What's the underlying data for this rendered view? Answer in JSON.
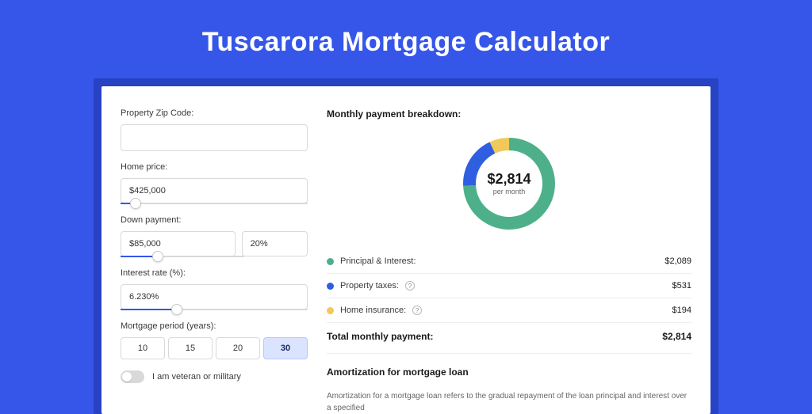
{
  "title": "Tuscarora Mortgage Calculator",
  "form": {
    "zip": {
      "label": "Property Zip Code:",
      "value": ""
    },
    "price": {
      "label": "Home price:",
      "value": "$425,000",
      "slider_pct": 8
    },
    "down": {
      "label": "Down payment:",
      "amount": "$85,000",
      "pct": "20%",
      "slider_pct": 20
    },
    "rate": {
      "label": "Interest rate (%):",
      "value": "6.230%",
      "slider_pct": 30
    },
    "period": {
      "label": "Mortgage period (years):",
      "options": [
        "10",
        "15",
        "20",
        "30"
      ],
      "active": "30"
    },
    "veteran_label": "I am veteran or military"
  },
  "breakdown": {
    "title": "Monthly payment breakdown:",
    "center_amount": "$2,814",
    "center_label": "per month",
    "items": [
      {
        "label": "Principal & Interest:",
        "value": "$2,089",
        "color": "#4db08b",
        "info": false,
        "num": 2089
      },
      {
        "label": "Property taxes:",
        "value": "$531",
        "color": "#2f5fe0",
        "info": true,
        "num": 531
      },
      {
        "label": "Home insurance:",
        "value": "$194",
        "color": "#f0c95a",
        "info": true,
        "num": 194
      }
    ],
    "total_label": "Total monthly payment:",
    "total_value": "$2,814"
  },
  "amort": {
    "title": "Amortization for mortgage loan",
    "text": "Amortization for a mortgage loan refers to the gradual repayment of the loan principal and interest over a specified"
  },
  "chart_data": {
    "type": "pie",
    "title": "Monthly payment breakdown",
    "categories": [
      "Principal & Interest",
      "Property taxes",
      "Home insurance"
    ],
    "values": [
      2089,
      531,
      194
    ],
    "colors": [
      "#4db08b",
      "#2f5fe0",
      "#f0c95a"
    ],
    "total": 2814,
    "center_label": "$2,814 per month"
  }
}
